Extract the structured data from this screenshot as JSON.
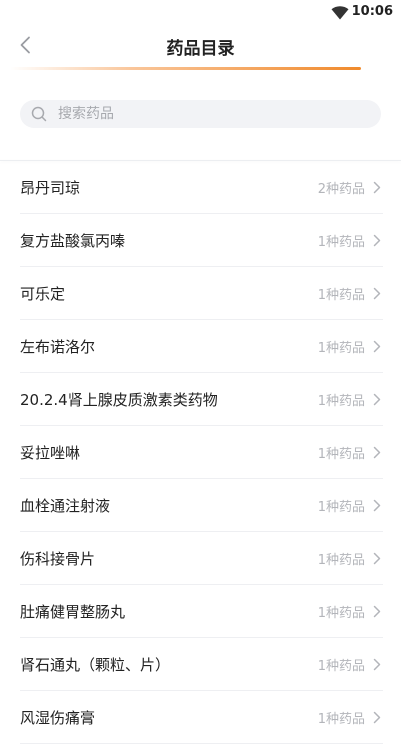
{
  "status_bar": {
    "time": "10:06",
    "wifi_icon": "wifi-icon"
  },
  "header": {
    "title": "药品目录",
    "back_icon": "chevron-left-icon",
    "accent_color": "#f08a2c"
  },
  "search": {
    "placeholder": "搜索药品",
    "value": ""
  },
  "items": [
    {
      "name": "昂丹司琼",
      "count": "2种药品"
    },
    {
      "name": "复方盐酸氯丙嗪",
      "count": "1种药品"
    },
    {
      "name": "可乐定",
      "count": "1种药品"
    },
    {
      "name": "左布诺洛尔",
      "count": "1种药品"
    },
    {
      "name": "20.2.4肾上腺皮质激素类药物",
      "count": "1种药品"
    },
    {
      "name": "妥拉唑啉",
      "count": "1种药品"
    },
    {
      "name": "血栓通注射液",
      "count": "1种药品"
    },
    {
      "name": "伤科接骨片",
      "count": "1种药品"
    },
    {
      "name": "肚痛健胃整肠丸",
      "count": "1种药品"
    },
    {
      "name": "肾石通丸（颗粒、片）",
      "count": "1种药品"
    },
    {
      "name": "风湿伤痛膏",
      "count": "1种药品"
    }
  ]
}
